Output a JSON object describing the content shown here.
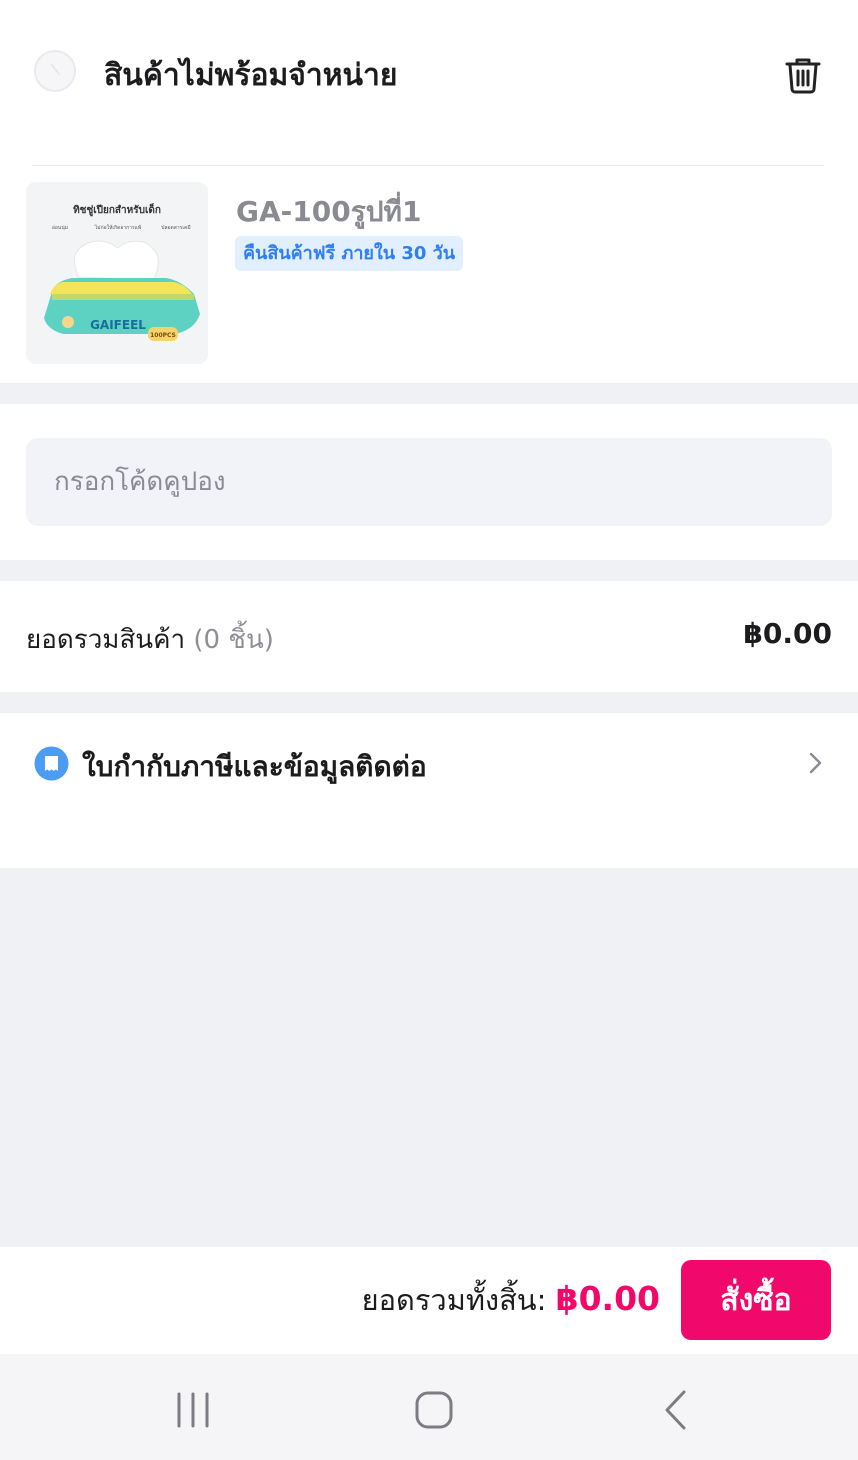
{
  "unavailable": {
    "title": "สินค้าไม่พร้อมจำหน่าย"
  },
  "product": {
    "name": "GA-100รูปที่1",
    "return_badge": "คืนสินค้าฟรี ภายใน 30 วัน",
    "image_text": {
      "top_label": "ทิชชู่เปียกสำหรับเด็ก",
      "feature_1": "อ่อนนุ่ม",
      "feature_2": "ไม่ก่อให้เกิดอาการแพ้",
      "feature_3": "ปลอดสารเคมี",
      "brand": "GAIFEEL",
      "count": "100PCS"
    }
  },
  "coupon": {
    "placeholder": "กรอกโค้ดคูปอง"
  },
  "subtotal": {
    "label": "ยอดรวมสินค้า",
    "count": "(0 ชิ้น)",
    "amount": "฿0.00"
  },
  "tax": {
    "label": "ใบกำกับภาษีและข้อมูลติดต่อ"
  },
  "bottom": {
    "total_label": "ยอดรวมทั้งสิ้น: ",
    "total_amount": "฿0.00",
    "order_button": "สั่งซื้อ"
  },
  "colors": {
    "accent": "#f0086b",
    "badge_bg": "#e2efff",
    "badge_text": "#2f7ef5",
    "tax_icon": "#4a9cf5"
  },
  "icons": {
    "radio": "disabled-radio-icon",
    "trash": "trash-icon",
    "receipt": "receipt-icon",
    "chevron": "chevron-right-icon",
    "nav_recent": "recent-apps-icon",
    "nav_home": "home-icon",
    "nav_back": "back-icon"
  }
}
